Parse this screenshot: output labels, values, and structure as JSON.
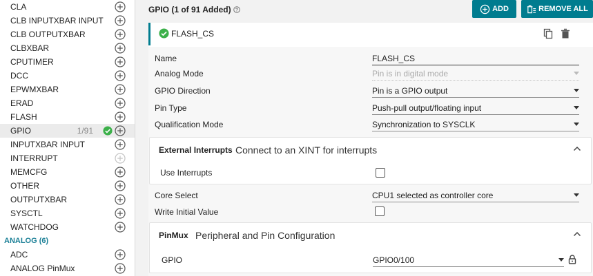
{
  "sidebar": {
    "items": [
      {
        "label": "CLA"
      },
      {
        "label": "CLB INPUTXBAR INPUT"
      },
      {
        "label": "CLB OUTPUTXBAR"
      },
      {
        "label": "CLBXBAR"
      },
      {
        "label": "CPUTIMER"
      },
      {
        "label": "DCC"
      },
      {
        "label": "EPWMXBAR"
      },
      {
        "label": "ERAD"
      },
      {
        "label": "FLASH"
      },
      {
        "label": "GPIO",
        "count": "1/91",
        "added": true,
        "active": true
      },
      {
        "label": "INPUTXBAR INPUT"
      },
      {
        "label": "INTERRUPT",
        "disabled": true
      },
      {
        "label": "MEMCFG"
      },
      {
        "label": "OTHER"
      },
      {
        "label": "OUTPUTXBAR"
      },
      {
        "label": "SYSCTL"
      },
      {
        "label": "WATCHDOG"
      }
    ],
    "section_label": "ANALOG (6)",
    "section_items": [
      {
        "label": "ADC"
      },
      {
        "label": "ANALOG PinMux"
      }
    ]
  },
  "header": {
    "title": "GPIO (1 of 91 Added)",
    "add_label": "ADD",
    "remove_all_label": "REMOVE ALL"
  },
  "instance": {
    "name": "FLASH_CS"
  },
  "form": {
    "name_label": "Name",
    "name_value": "FLASH_CS",
    "analog_mode_label": "Analog Mode",
    "analog_mode_value": "Pin is in digital mode",
    "gpio_direction_label": "GPIO Direction",
    "gpio_direction_value": "Pin is a GPIO output",
    "pin_type_label": "Pin Type",
    "pin_type_value": "Push-pull output/floating input",
    "qualification_mode_label": "Qualification Mode",
    "qualification_mode_value": "Synchronization to SYSCLK",
    "ext_int_title": "External Interrupts",
    "ext_int_desc": "Connect to an XINT for interrupts",
    "use_interrupts_label": "Use Interrupts",
    "use_interrupts_checked": false,
    "core_select_label": "Core Select",
    "core_select_value": "CPU1 selected as controller core",
    "write_initial_label": "Write Initial Value",
    "write_initial_checked": false,
    "pinmux_title": "PinMux",
    "pinmux_desc": "Peripheral and Pin Configuration",
    "gpio_label": "GPIO",
    "gpio_value": "GPIO0/100"
  },
  "colors": {
    "accent": "#007c8f",
    "success": "#3cb04a",
    "section_label": "#1a7f96"
  },
  "icons": [
    "add-circle-icon",
    "check-circle-icon",
    "help-icon",
    "copy-icon",
    "delete-icon",
    "chevron-up-icon",
    "lock-icon"
  ]
}
